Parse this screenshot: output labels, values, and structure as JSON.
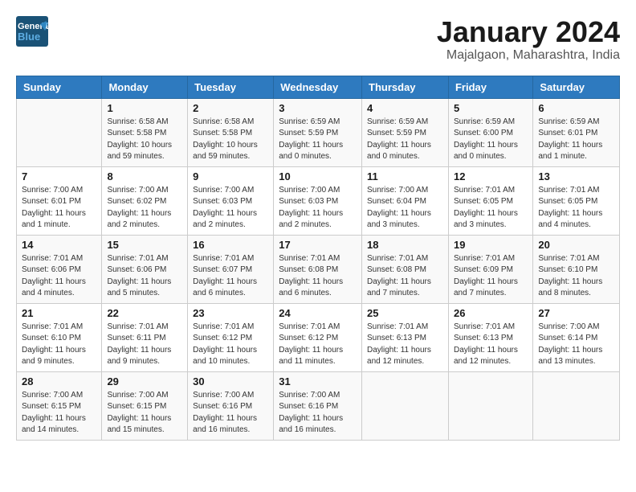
{
  "header": {
    "logo_general": "General",
    "logo_blue": "Blue",
    "month_title": "January 2024",
    "location": "Majalgaon, Maharashtra, India"
  },
  "days_of_week": [
    "Sunday",
    "Monday",
    "Tuesday",
    "Wednesday",
    "Thursday",
    "Friday",
    "Saturday"
  ],
  "weeks": [
    [
      {
        "day": "",
        "sunrise": "",
        "sunset": "",
        "daylight": ""
      },
      {
        "day": "1",
        "sunrise": "Sunrise: 6:58 AM",
        "sunset": "Sunset: 5:58 PM",
        "daylight": "Daylight: 10 hours and 59 minutes."
      },
      {
        "day": "2",
        "sunrise": "Sunrise: 6:58 AM",
        "sunset": "Sunset: 5:58 PM",
        "daylight": "Daylight: 10 hours and 59 minutes."
      },
      {
        "day": "3",
        "sunrise": "Sunrise: 6:59 AM",
        "sunset": "Sunset: 5:59 PM",
        "daylight": "Daylight: 11 hours and 0 minutes."
      },
      {
        "day": "4",
        "sunrise": "Sunrise: 6:59 AM",
        "sunset": "Sunset: 5:59 PM",
        "daylight": "Daylight: 11 hours and 0 minutes."
      },
      {
        "day": "5",
        "sunrise": "Sunrise: 6:59 AM",
        "sunset": "Sunset: 6:00 PM",
        "daylight": "Daylight: 11 hours and 0 minutes."
      },
      {
        "day": "6",
        "sunrise": "Sunrise: 6:59 AM",
        "sunset": "Sunset: 6:01 PM",
        "daylight": "Daylight: 11 hours and 1 minute."
      }
    ],
    [
      {
        "day": "7",
        "sunrise": "Sunrise: 7:00 AM",
        "sunset": "Sunset: 6:01 PM",
        "daylight": "Daylight: 11 hours and 1 minute."
      },
      {
        "day": "8",
        "sunrise": "Sunrise: 7:00 AM",
        "sunset": "Sunset: 6:02 PM",
        "daylight": "Daylight: 11 hours and 2 minutes."
      },
      {
        "day": "9",
        "sunrise": "Sunrise: 7:00 AM",
        "sunset": "Sunset: 6:03 PM",
        "daylight": "Daylight: 11 hours and 2 minutes."
      },
      {
        "day": "10",
        "sunrise": "Sunrise: 7:00 AM",
        "sunset": "Sunset: 6:03 PM",
        "daylight": "Daylight: 11 hours and 2 minutes."
      },
      {
        "day": "11",
        "sunrise": "Sunrise: 7:00 AM",
        "sunset": "Sunset: 6:04 PM",
        "daylight": "Daylight: 11 hours and 3 minutes."
      },
      {
        "day": "12",
        "sunrise": "Sunrise: 7:01 AM",
        "sunset": "Sunset: 6:05 PM",
        "daylight": "Daylight: 11 hours and 3 minutes."
      },
      {
        "day": "13",
        "sunrise": "Sunrise: 7:01 AM",
        "sunset": "Sunset: 6:05 PM",
        "daylight": "Daylight: 11 hours and 4 minutes."
      }
    ],
    [
      {
        "day": "14",
        "sunrise": "Sunrise: 7:01 AM",
        "sunset": "Sunset: 6:06 PM",
        "daylight": "Daylight: 11 hours and 4 minutes."
      },
      {
        "day": "15",
        "sunrise": "Sunrise: 7:01 AM",
        "sunset": "Sunset: 6:06 PM",
        "daylight": "Daylight: 11 hours and 5 minutes."
      },
      {
        "day": "16",
        "sunrise": "Sunrise: 7:01 AM",
        "sunset": "Sunset: 6:07 PM",
        "daylight": "Daylight: 11 hours and 6 minutes."
      },
      {
        "day": "17",
        "sunrise": "Sunrise: 7:01 AM",
        "sunset": "Sunset: 6:08 PM",
        "daylight": "Daylight: 11 hours and 6 minutes."
      },
      {
        "day": "18",
        "sunrise": "Sunrise: 7:01 AM",
        "sunset": "Sunset: 6:08 PM",
        "daylight": "Daylight: 11 hours and 7 minutes."
      },
      {
        "day": "19",
        "sunrise": "Sunrise: 7:01 AM",
        "sunset": "Sunset: 6:09 PM",
        "daylight": "Daylight: 11 hours and 7 minutes."
      },
      {
        "day": "20",
        "sunrise": "Sunrise: 7:01 AM",
        "sunset": "Sunset: 6:10 PM",
        "daylight": "Daylight: 11 hours and 8 minutes."
      }
    ],
    [
      {
        "day": "21",
        "sunrise": "Sunrise: 7:01 AM",
        "sunset": "Sunset: 6:10 PM",
        "daylight": "Daylight: 11 hours and 9 minutes."
      },
      {
        "day": "22",
        "sunrise": "Sunrise: 7:01 AM",
        "sunset": "Sunset: 6:11 PM",
        "daylight": "Daylight: 11 hours and 9 minutes."
      },
      {
        "day": "23",
        "sunrise": "Sunrise: 7:01 AM",
        "sunset": "Sunset: 6:12 PM",
        "daylight": "Daylight: 11 hours and 10 minutes."
      },
      {
        "day": "24",
        "sunrise": "Sunrise: 7:01 AM",
        "sunset": "Sunset: 6:12 PM",
        "daylight": "Daylight: 11 hours and 11 minutes."
      },
      {
        "day": "25",
        "sunrise": "Sunrise: 7:01 AM",
        "sunset": "Sunset: 6:13 PM",
        "daylight": "Daylight: 11 hours and 12 minutes."
      },
      {
        "day": "26",
        "sunrise": "Sunrise: 7:01 AM",
        "sunset": "Sunset: 6:13 PM",
        "daylight": "Daylight: 11 hours and 12 minutes."
      },
      {
        "day": "27",
        "sunrise": "Sunrise: 7:00 AM",
        "sunset": "Sunset: 6:14 PM",
        "daylight": "Daylight: 11 hours and 13 minutes."
      }
    ],
    [
      {
        "day": "28",
        "sunrise": "Sunrise: 7:00 AM",
        "sunset": "Sunset: 6:15 PM",
        "daylight": "Daylight: 11 hours and 14 minutes."
      },
      {
        "day": "29",
        "sunrise": "Sunrise: 7:00 AM",
        "sunset": "Sunset: 6:15 PM",
        "daylight": "Daylight: 11 hours and 15 minutes."
      },
      {
        "day": "30",
        "sunrise": "Sunrise: 7:00 AM",
        "sunset": "Sunset: 6:16 PM",
        "daylight": "Daylight: 11 hours and 16 minutes."
      },
      {
        "day": "31",
        "sunrise": "Sunrise: 7:00 AM",
        "sunset": "Sunset: 6:16 PM",
        "daylight": "Daylight: 11 hours and 16 minutes."
      },
      {
        "day": "",
        "sunrise": "",
        "sunset": "",
        "daylight": ""
      },
      {
        "day": "",
        "sunrise": "",
        "sunset": "",
        "daylight": ""
      },
      {
        "day": "",
        "sunrise": "",
        "sunset": "",
        "daylight": ""
      }
    ]
  ]
}
